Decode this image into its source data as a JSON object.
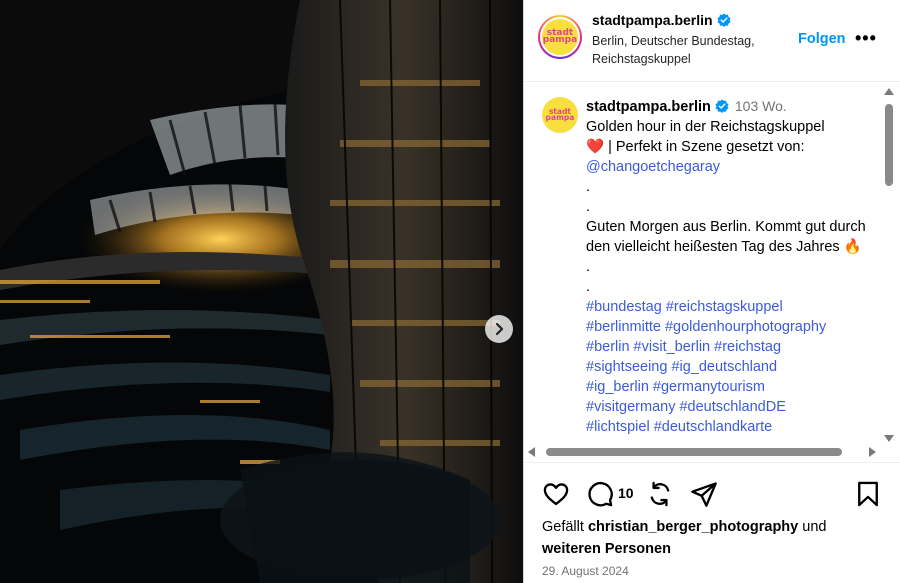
{
  "header": {
    "username": "stadtpampa.berlin",
    "location": "Berlin, Deutscher Bundestag, Reichstagskuppel",
    "follow_label": "Folgen",
    "more_label": "•••",
    "avatar_text_1": "stadt",
    "avatar_text_2": "pampa"
  },
  "caption": {
    "username": "stadtpampa.berlin",
    "age": "103 Wo.",
    "line1": "Golden hour in der Reichstagskuppel",
    "line2": "❤️ | Perfekt in Szene gesetzt von:",
    "mention": "@changoetchegaray",
    "dot1": ".",
    "dot2": ".",
    "para2": "Guten Morgen aus Berlin. Kommt gut durch den vielleicht heißesten Tag des Jahres 🔥",
    "dot3": ".",
    "dot4": ".",
    "hashtags": [
      "#bundestag #reichstagskuppel",
      "#berlinmitte #goldenhourphotography",
      "#berlin #visit_berlin #reichstag",
      "#sightseeing #ig_deutschland",
      "#ig_berlin #germanytourism",
      "#visitgermany #deutschlandDE",
      "#lichtspiel #deutschlandkarte"
    ]
  },
  "actions": {
    "comment_count": "10"
  },
  "likes": {
    "prefix": "Gefällt ",
    "user": "christian_berger_photography",
    "middle": " und",
    "others": "weiteren Personen"
  },
  "date": "29. August 2024",
  "colors": {
    "link": "#3b5bdb",
    "follow": "#0095f6",
    "verified": "#0095f6"
  },
  "icons": [
    "verified-icon",
    "next-arrow-icon",
    "heart-icon",
    "comment-icon",
    "repost-icon",
    "share-icon",
    "bookmark-icon"
  ]
}
